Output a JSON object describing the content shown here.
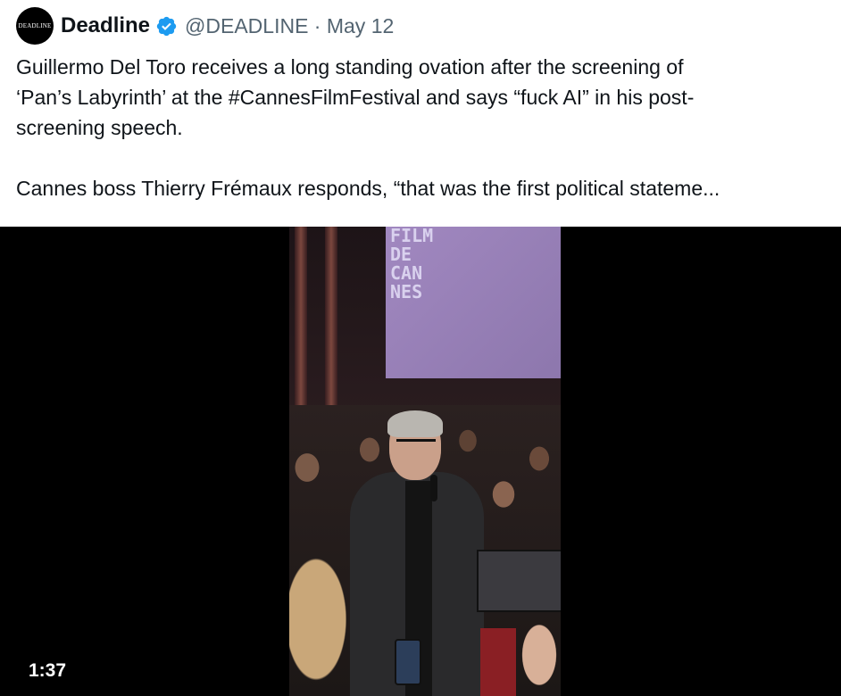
{
  "tweet": {
    "avatar_text": "DEADLINE",
    "author_name": "Deadline",
    "verified_icon": "verified-badge-icon",
    "handle_date": "@DEADLINE · May 12",
    "text": "Guillermo Del Toro receives a long standing ovation after the screening of\n‘Pan’s Labyrinth’ at the #CannesFilmFestival and says “fuck AI” in his post-\nscreening speech.\n\nCannes boss Thierry Frémaux responds, “that was the first political stateme..."
  },
  "video": {
    "screen_text": "FILM\nDE\nCAN\nNES",
    "duration": "1:37"
  },
  "colors": {
    "verified_blue": "#1d9bf0",
    "handle_gray": "#536471",
    "video_bg": "#000000"
  }
}
